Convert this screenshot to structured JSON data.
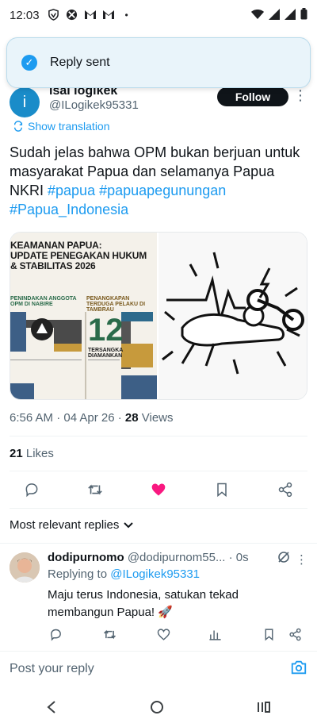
{
  "status_bar": {
    "time": "12:03",
    "dot": "•"
  },
  "toast": {
    "message": "Reply sent"
  },
  "tweet": {
    "author_name": "isal logikek",
    "author_handle": "@ILogikek95331",
    "avatar_letter": "i",
    "follow_label": "Follow",
    "show_translation": "Show translation",
    "text_plain": "Sudah jelas bahwa OPM bukan berjuan untuk masyarakat Papua dan selamanya Papua NKRI ",
    "hashtags": [
      "#papua",
      "#papuapegunungan",
      "#Papua_Indonesia"
    ],
    "timestamp": "6:56 AM · 04 Apr 26 · ",
    "views_count": "28",
    "views_label": " Views",
    "likes_count": "21",
    "likes_label": " Likes"
  },
  "media": {
    "infographic": {
      "title_line1": "KEAMANAN PAPUA:",
      "title_line2": "UPDATE PENEGAKAN HUKUM",
      "title_line3": "& STABILITAS 2026",
      "section1": "PENINDAKAN ANGGOTA OPM DI NABIRE",
      "section2": "PENANGKAPAN TERDUGA PELAKU DI TAMBRAU",
      "big_number": "12",
      "big_number_label": "TERSANGKA DIAMANKAN"
    }
  },
  "replies_sort": {
    "label": "Most relevant replies"
  },
  "reply": {
    "name": "dodipurnomo",
    "handle": "@dodipurnom55...",
    "time": " · 0s",
    "replying_prefix": "Replying to ",
    "replying_to": "@ILogikek95331",
    "body": "Maju terus Indonesia, satukan tekad membangun Papua! 🚀"
  },
  "composer": {
    "placeholder": "Post your reply"
  },
  "colors": {
    "accent": "#1d9bf0",
    "like": "#f91880",
    "text": "#0f1419",
    "muted": "#536471"
  }
}
